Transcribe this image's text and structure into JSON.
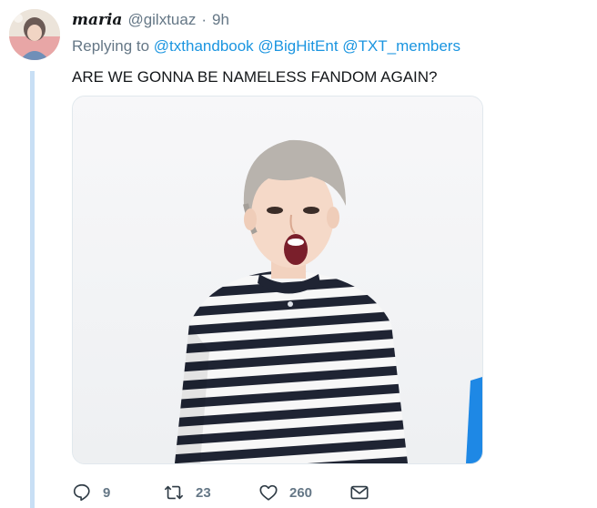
{
  "tweet": {
    "display_name": "maria",
    "handle": "@gilxtuaz",
    "separator": "·",
    "time": "9h",
    "replying_prefix": "Replying to",
    "mentions": [
      "@txthandbook",
      "@BigHitEnt",
      "@TXT_members"
    ],
    "text": "ARE WE GONNA BE NAMELESS FANDOM AGAIN?"
  },
  "actions": {
    "reply_count": "9",
    "retweet_count": "23",
    "like_count": "260"
  },
  "icons": {
    "reply": "reply-icon",
    "retweet": "retweet-icon",
    "like": "heart-icon",
    "message": "envelope-icon"
  },
  "colors": {
    "link": "#1b95e0",
    "secondary_text": "#657786",
    "thread_line": "#c8dff5"
  }
}
